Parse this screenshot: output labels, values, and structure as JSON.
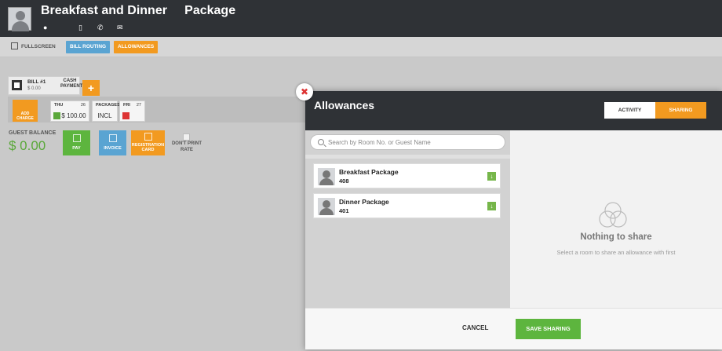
{
  "header": {
    "guest_name": "Breakfast and Dinner     Package",
    "icons": [
      "location-icon",
      "mobile-icon",
      "phone-icon",
      "email-icon"
    ],
    "background_color": "#2f3236"
  },
  "toolbar": {
    "fullscreen_label": "FULLSCREEN",
    "bill_routing_label": "BILL ROUTING",
    "allowances_label": "ALLOWANCES"
  },
  "bill": {
    "title": "BILL #1",
    "amount": "$ 0.00",
    "payment_type": "CASH PAYMENT",
    "add_label": "+"
  },
  "charges": {
    "add_charge_label": "ADD CHARGE",
    "days": [
      {
        "day": "THU",
        "date": "26",
        "value": "$ 100.00"
      },
      {
        "day": "PACKAGES",
        "date": "",
        "value": "INCL"
      },
      {
        "day": "FRI",
        "date": "27",
        "value": ""
      }
    ]
  },
  "balance": {
    "label": "GUEST BALANCE",
    "value": "$ 0.00"
  },
  "actions": {
    "pay_label": "PAY",
    "invoice_label": "INVOICE",
    "registration_label": "REGISTRATION CARD",
    "dont_print_label": "DON'T PRINT RATE"
  },
  "modal": {
    "title": "Allowances",
    "close_symbol": "✖",
    "tabs": {
      "activity": "ACTIVITY",
      "sharing": "SHARING"
    },
    "search": {
      "placeholder": "Search by Room No. or Guest Name",
      "value": ""
    },
    "rooms": [
      {
        "name": "Breakfast Package",
        "room": "408"
      },
      {
        "name": "Dinner Package",
        "room": "401"
      }
    ],
    "empty_state": {
      "title": "Nothing to share",
      "subtitle": "Select a room to share an allowance with first"
    },
    "cancel_label": "CANCEL",
    "save_label": "SAVE SHARING"
  },
  "colors": {
    "accent_orange": "#f29a20",
    "accent_green": "#5db53e",
    "accent_blue": "#5aa4d2",
    "close_red": "#dd3333"
  }
}
